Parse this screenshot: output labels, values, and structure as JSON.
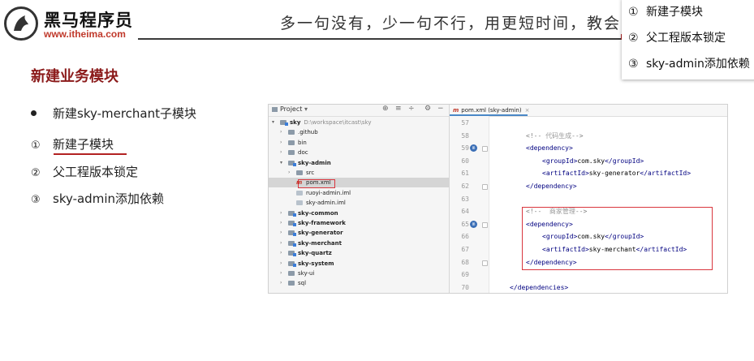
{
  "brand": {
    "name": "黑马程序员",
    "url": "www.itheima.com"
  },
  "slogan": "多一句没有，少一句不行，用更短时间，教会",
  "popup": {
    "items": [
      {
        "num": "①",
        "label": "新建子模块"
      },
      {
        "num": "②",
        "label": "父工程版本锁定"
      },
      {
        "num": "③",
        "label": "sky-admin添加依赖"
      }
    ]
  },
  "page_title": "新建业务模块",
  "bullet": "新建sky-merchant子模块",
  "steps": [
    {
      "num": "①",
      "label": "新建子模块"
    },
    {
      "num": "②",
      "label": "父工程版本锁定"
    },
    {
      "num": "③",
      "label": "sky-admin添加依赖"
    }
  ],
  "ide": {
    "project_label": "Project",
    "tab_label": "pom.xml (sky-admin)",
    "tree": [
      {
        "name": "sky",
        "path": "D:\\workspace\\itcast\\sky",
        "bold": true
      },
      {
        "name": ".github"
      },
      {
        "name": "bin"
      },
      {
        "name": "doc"
      },
      {
        "name": "sky-admin",
        "bold": true
      },
      {
        "name": "src"
      },
      {
        "name": "pom.xml"
      },
      {
        "name": "ruoyi-admin.iml"
      },
      {
        "name": "sky-admin.iml"
      },
      {
        "name": "sky-common",
        "bold": true
      },
      {
        "name": "sky-framework",
        "bold": true
      },
      {
        "name": "sky-generator",
        "bold": true
      },
      {
        "name": "sky-merchant",
        "bold": true
      },
      {
        "name": "sky-quartz",
        "bold": true
      },
      {
        "name": "sky-system",
        "bold": true
      },
      {
        "name": "sky-ui"
      },
      {
        "name": "sql"
      }
    ],
    "code": [
      {
        "ln": "57",
        "text": ""
      },
      {
        "ln": "58",
        "text": "<!-- 代码生成-->"
      },
      {
        "ln": "59",
        "text": "<dependency>"
      },
      {
        "ln": "60",
        "text": "<groupId>com.sky</groupId>"
      },
      {
        "ln": "61",
        "text": "<artifactId>sky-generator</artifactId>"
      },
      {
        "ln": "62",
        "text": "</dependency>"
      },
      {
        "ln": "63",
        "text": ""
      },
      {
        "ln": "64",
        "text": "<!--  商家管理-->"
      },
      {
        "ln": "65",
        "text": "<dependency>"
      },
      {
        "ln": "66",
        "text": "<groupId>com.sky</groupId>"
      },
      {
        "ln": "67",
        "text": "<artifactId>sky-merchant</artifactId>"
      },
      {
        "ln": "68",
        "text": "</dependency>"
      },
      {
        "ln": "69",
        "text": ""
      },
      {
        "ln": "70",
        "text": "</dependencies>"
      }
    ]
  }
}
